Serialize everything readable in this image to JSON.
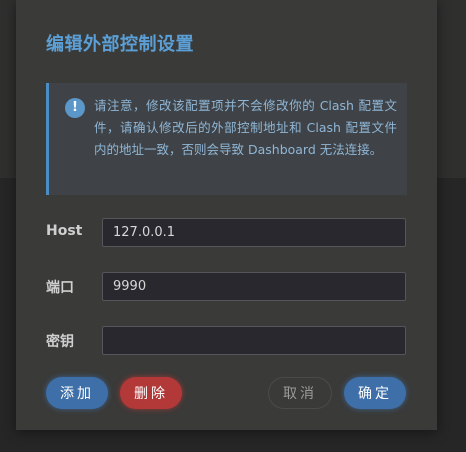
{
  "dialog": {
    "title": "编辑外部控制设置",
    "notice": {
      "icon": "info-icon",
      "icon_glyph": "!",
      "text": "请注意，修改该配置项并不会修改你的 Clash 配置文件，请确认修改后的外部控制地址和 Clash 配置文件内的地址一致，否则会导致 Dashboard 无法连接。"
    },
    "fields": {
      "host": {
        "label": "Host",
        "value": "127.0.0.1"
      },
      "port": {
        "label": "端口",
        "value": "9990"
      },
      "secret": {
        "label": "密钥",
        "value": ""
      }
    },
    "buttons": {
      "add": "添加",
      "delete": "删除",
      "cancel": "取消",
      "confirm": "确定"
    }
  },
  "colors": {
    "accent": "#5b9fd6",
    "primary_button": "#3e6fa8",
    "danger_button": "#b33939",
    "dialog_background": "#3a3a38"
  }
}
